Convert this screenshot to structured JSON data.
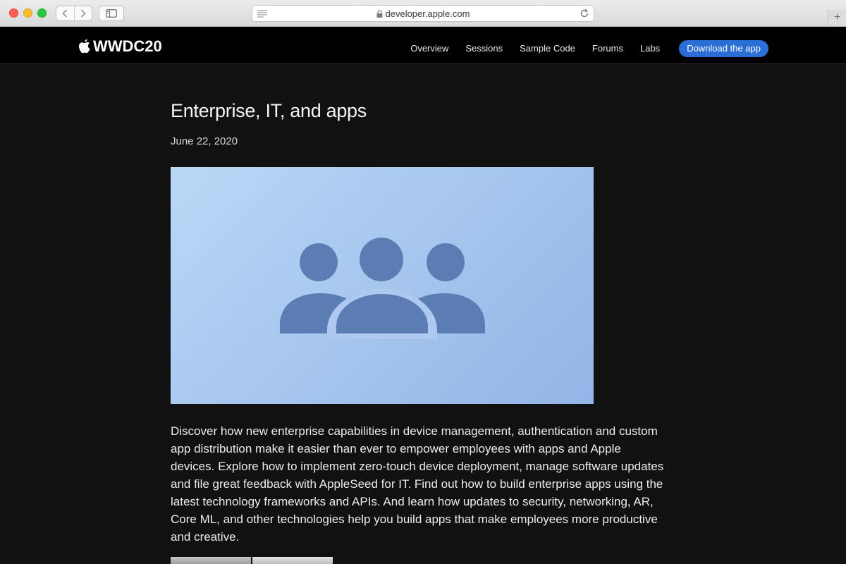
{
  "browser": {
    "url": "developer.apple.com"
  },
  "header": {
    "brand": "WWDC20",
    "nav": [
      {
        "label": "Overview"
      },
      {
        "label": "Sessions"
      },
      {
        "label": "Sample Code"
      },
      {
        "label": "Forums"
      },
      {
        "label": "Labs"
      }
    ],
    "download_label": "Download the app"
  },
  "article": {
    "title": "Enterprise, IT, and apps",
    "date": "June 22, 2020",
    "hero_icon": "person-3-icon",
    "body": "Discover how new enterprise capabilities in device management, authentication and custom app distribution make it easier than ever to empower employees with apps and Apple devices. Explore how to implement zero-touch device deployment, manage software updates and file great feedback with AppleSeed for IT. Find out how to build enterprise apps using the latest technology frameworks and APIs. And learn how updates to security, networking, AR, Core ML, and other technologies help you build apps that make employees more productive and creative."
  },
  "colors": {
    "page_background": "#111111",
    "header_background": "#000000",
    "accent": "#2b6fd6",
    "hero_gradient_start": "#bad7f6",
    "hero_gradient_end": "#93b5e7",
    "icon_fill": "#5b7db3"
  }
}
